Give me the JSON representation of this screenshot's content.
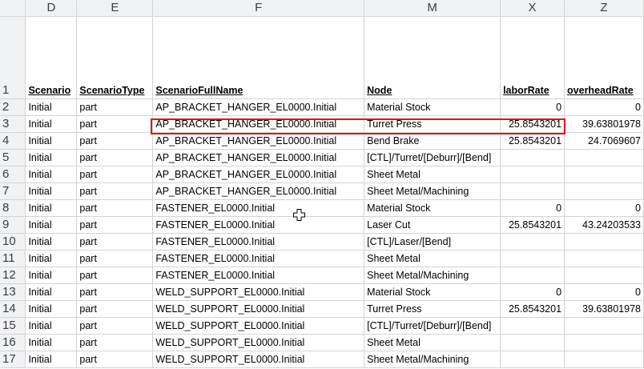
{
  "columns": [
    "D",
    "E",
    "F",
    "M",
    "X",
    "Z"
  ],
  "header_row": {
    "num": "1",
    "cells": [
      "Scenario",
      "ScenarioType",
      "ScenarioFullName",
      "Node",
      "laborRate",
      "overheadRate"
    ]
  },
  "rows": [
    {
      "num": "2",
      "cells": [
        "Initial",
        "part",
        "AP_BRACKET_HANGER_EL0000.Initial",
        "Material Stock",
        "0",
        "0"
      ]
    },
    {
      "num": "3",
      "cells": [
        "Initial",
        "part",
        "AP_BRACKET_HANGER_EL0000.Initial",
        "Turret Press",
        "25.8543201",
        "39.63801978"
      ]
    },
    {
      "num": "4",
      "cells": [
        "Initial",
        "part",
        "AP_BRACKET_HANGER_EL0000.Initial",
        "Bend Brake",
        "25.8543201",
        "24.7069607"
      ]
    },
    {
      "num": "5",
      "cells": [
        "Initial",
        "part",
        "AP_BRACKET_HANGER_EL0000.Initial",
        "[CTL]/Turret/[Deburr]/[Bend]",
        "",
        ""
      ]
    },
    {
      "num": "6",
      "cells": [
        "Initial",
        "part",
        "AP_BRACKET_HANGER_EL0000.Initial",
        "Sheet Metal",
        "",
        ""
      ]
    },
    {
      "num": "7",
      "cells": [
        "Initial",
        "part",
        "AP_BRACKET_HANGER_EL0000.Initial",
        "Sheet Metal/Machining",
        "",
        ""
      ]
    },
    {
      "num": "8",
      "cells": [
        "Initial",
        "part",
        "FASTENER_EL0000.Initial",
        "Material Stock",
        "0",
        "0"
      ]
    },
    {
      "num": "9",
      "cells": [
        "Initial",
        "part",
        "FASTENER_EL0000.Initial",
        "Laser Cut",
        "25.8543201",
        "43.24203533"
      ]
    },
    {
      "num": "10",
      "cells": [
        "Initial",
        "part",
        "FASTENER_EL0000.Initial",
        "[CTL]/Laser/[Bend]",
        "",
        ""
      ]
    },
    {
      "num": "11",
      "cells": [
        "Initial",
        "part",
        "FASTENER_EL0000.Initial",
        "Sheet Metal",
        "",
        ""
      ]
    },
    {
      "num": "12",
      "cells": [
        "Initial",
        "part",
        "FASTENER_EL0000.Initial",
        "Sheet Metal/Machining",
        "",
        ""
      ]
    },
    {
      "num": "13",
      "cells": [
        "Initial",
        "part",
        "WELD_SUPPORT_EL0000.Initial",
        "Material Stock",
        "0",
        "0"
      ]
    },
    {
      "num": "14",
      "cells": [
        "Initial",
        "part",
        "WELD_SUPPORT_EL0000.Initial",
        "Turret Press",
        "25.8543201",
        "39.63801978"
      ]
    },
    {
      "num": "15",
      "cells": [
        "Initial",
        "part",
        "WELD_SUPPORT_EL0000.Initial",
        "[CTL]/Turret/[Deburr]/[Bend]",
        "",
        ""
      ]
    },
    {
      "num": "16",
      "cells": [
        "Initial",
        "part",
        "WELD_SUPPORT_EL0000.Initial",
        "Sheet Metal",
        "",
        ""
      ]
    },
    {
      "num": "17",
      "cells": [
        "Initial",
        "part",
        "WELD_SUPPORT_EL0000.Initial",
        "Sheet Metal/Machining",
        "",
        ""
      ]
    }
  ],
  "highlight_row": "3",
  "colors": {
    "highlight": "#e0141b",
    "header_bg": "#f1f2f4",
    "grid": "#d4d4d4"
  },
  "icons": {
    "cursor": "cell-select-cursor-icon"
  }
}
